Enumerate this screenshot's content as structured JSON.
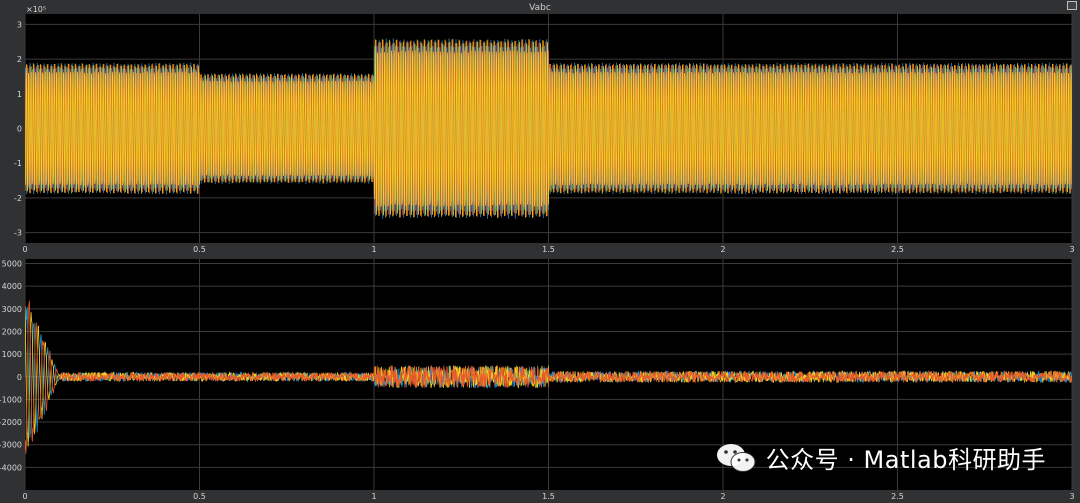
{
  "window": {
    "title": "Vabc"
  },
  "watermark": {
    "text": "公众号 · Matlab科研助手",
    "icon": "wechat-icon"
  },
  "colors": {
    "background": "#000000",
    "frame": "#2f3133",
    "grid": "#3a3a3a",
    "text": "#d7d7d7"
  },
  "chart_data": [
    {
      "type": "line",
      "title": "Vabc",
      "exponent_label": "×10⁵",
      "x_ticks": [
        "0",
        "0.5",
        "1",
        "1.5",
        "2",
        "2.5",
        "3"
      ],
      "y_ticks": [
        "3",
        "2",
        "1",
        "0",
        "-1",
        "-2",
        "-3"
      ],
      "xlim": [
        0,
        3
      ],
      "ylim": [
        -3.3,
        3.3
      ],
      "grid": true,
      "series": [
        {
          "color": "#1e90d6",
          "phase": 0
        },
        {
          "color": "#e8592b",
          "phase": 2.094
        },
        {
          "color": "#f2d21c",
          "phase": 4.189
        }
      ],
      "envelope": [
        {
          "x_start": 0,
          "x_end": 0.5,
          "amplitude": 1.9
        },
        {
          "x_start": 0.5,
          "x_end": 1.0,
          "amplitude": 1.6
        },
        {
          "x_start": 1.0,
          "x_end": 1.5,
          "amplitude": 2.6
        },
        {
          "x_start": 1.5,
          "x_end": 3.0,
          "amplitude": 1.9
        }
      ]
    },
    {
      "type": "line",
      "title": "",
      "x_ticks": [
        "0",
        "0.5",
        "1",
        "1.5",
        "2",
        "2.5",
        "3"
      ],
      "y_ticks": [
        "5000",
        "4000",
        "3000",
        "2000",
        "1000",
        "0",
        "-1000",
        "-2000",
        "-3000",
        "-4000"
      ],
      "xlim": [
        0,
        3
      ],
      "ylim": [
        -5000,
        5200
      ],
      "grid": true,
      "series": [
        {
          "color": "#1e90d6",
          "phase": 0
        },
        {
          "color": "#f2d21c",
          "phase": 2.094
        },
        {
          "color": "#e8592b",
          "phase": 4.189
        }
      ],
      "transient": {
        "x_end": 0.1,
        "peak": 4100,
        "trough": -3800
      },
      "noise_segments": [
        {
          "x_start": 0.1,
          "x_end": 1.0,
          "amplitude": 200
        },
        {
          "x_start": 1.0,
          "x_end": 1.5,
          "amplitude": 500
        },
        {
          "x_start": 1.5,
          "x_end": 3.0,
          "amplitude": 250
        }
      ]
    }
  ]
}
